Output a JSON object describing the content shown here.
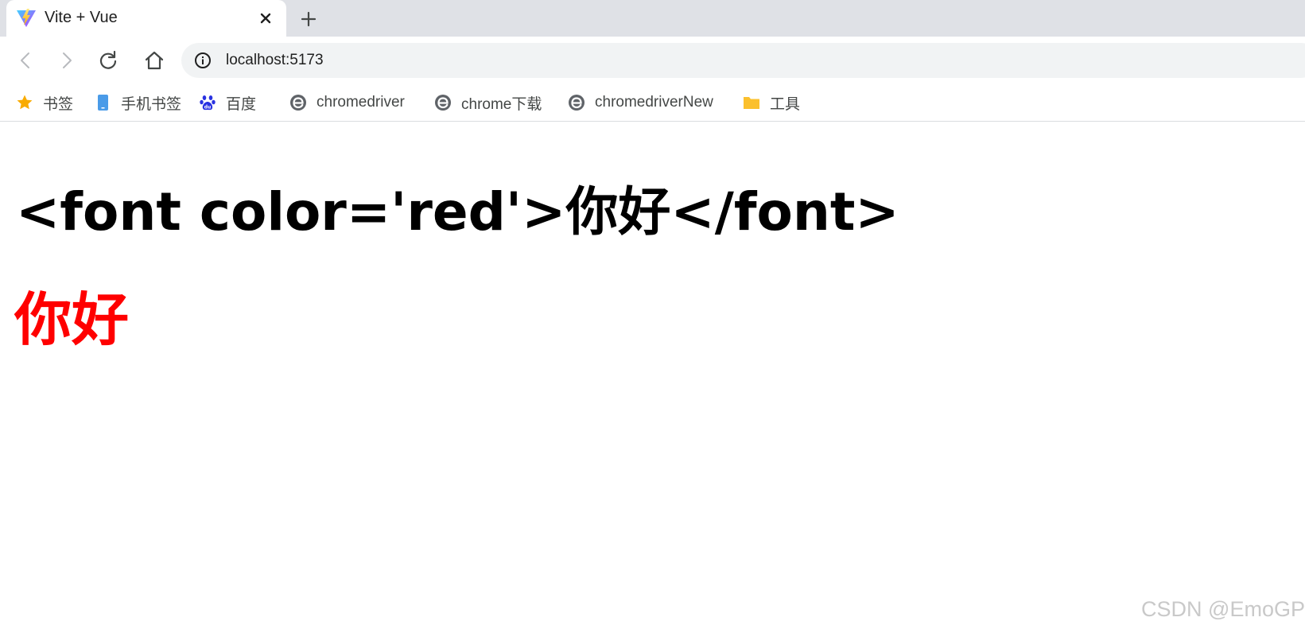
{
  "tab": {
    "favicon": "vite-logo-icon",
    "title": "Vite + Vue",
    "close_icon": "close-icon"
  },
  "new_tab_icon": "plus-icon",
  "toolbar": {
    "back_icon": "back-arrow-icon",
    "forward_icon": "forward-arrow-icon",
    "reload_icon": "reload-icon",
    "home_icon": "home-icon",
    "site_info_icon": "info-icon",
    "url": "localhost:5173"
  },
  "bookmarks": [
    {
      "label": "书签",
      "icon": "star-icon"
    },
    {
      "label": "手机书签",
      "icon": "phone-icon"
    },
    {
      "label": "百度",
      "icon": "baidu-paw-icon"
    },
    {
      "label": "chromedriver",
      "icon": "e-site-icon"
    },
    {
      "label": "chrome下载",
      "icon": "e-site-icon"
    },
    {
      "label": "chromedriverNew",
      "icon": "e-site-icon"
    },
    {
      "label": "工具",
      "icon": "folder-icon"
    }
  ],
  "content": {
    "raw_heading": "<font color='red'>你好</font>",
    "rendered_heading": "你好",
    "rendered_heading_color": "#ff0000"
  },
  "watermark": "CSDN @EmoGP",
  "colors": {
    "tabstrip_bg": "#dfe1e6",
    "omnibox_bg": "#f1f3f4",
    "star": "#f9ab00",
    "folder": "#fbc02d",
    "phone": "#4a9be8",
    "baidu": "#2932e1",
    "e_icon": "#5f6368"
  }
}
